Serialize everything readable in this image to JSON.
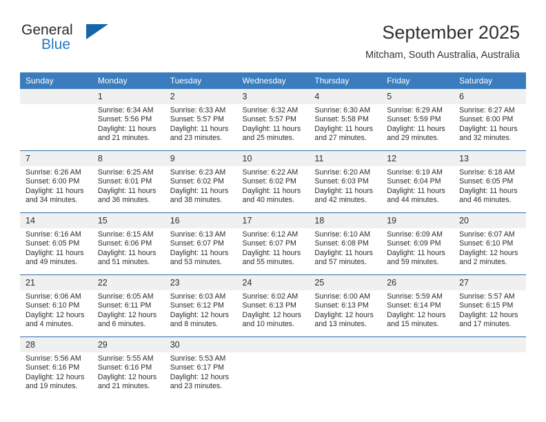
{
  "brand": {
    "name_part1": "General",
    "name_part2": "Blue",
    "flag_icon": "triangle-flag-icon"
  },
  "header": {
    "title": "September 2025",
    "location": "Mitcham, South Australia, Australia"
  },
  "weekday_headers": [
    "Sunday",
    "Monday",
    "Tuesday",
    "Wednesday",
    "Thursday",
    "Friday",
    "Saturday"
  ],
  "colors": {
    "header_blue": "#3a7cbe",
    "row_divider_blue": "#2e6da8",
    "daynum_band": "#f0f0f0",
    "brand_blue": "#2278c6"
  },
  "weeks": [
    [
      {
        "day": "",
        "sunrise": "",
        "sunset": "",
        "daylight_line1": "",
        "daylight_line2": "",
        "empty": true
      },
      {
        "day": "1",
        "sunrise": "Sunrise: 6:34 AM",
        "sunset": "Sunset: 5:56 PM",
        "daylight_line1": "Daylight: 11 hours",
        "daylight_line2": "and 21 minutes.",
        "empty": false
      },
      {
        "day": "2",
        "sunrise": "Sunrise: 6:33 AM",
        "sunset": "Sunset: 5:57 PM",
        "daylight_line1": "Daylight: 11 hours",
        "daylight_line2": "and 23 minutes.",
        "empty": false
      },
      {
        "day": "3",
        "sunrise": "Sunrise: 6:32 AM",
        "sunset": "Sunset: 5:57 PM",
        "daylight_line1": "Daylight: 11 hours",
        "daylight_line2": "and 25 minutes.",
        "empty": false
      },
      {
        "day": "4",
        "sunrise": "Sunrise: 6:30 AM",
        "sunset": "Sunset: 5:58 PM",
        "daylight_line1": "Daylight: 11 hours",
        "daylight_line2": "and 27 minutes.",
        "empty": false
      },
      {
        "day": "5",
        "sunrise": "Sunrise: 6:29 AM",
        "sunset": "Sunset: 5:59 PM",
        "daylight_line1": "Daylight: 11 hours",
        "daylight_line2": "and 29 minutes.",
        "empty": false
      },
      {
        "day": "6",
        "sunrise": "Sunrise: 6:27 AM",
        "sunset": "Sunset: 6:00 PM",
        "daylight_line1": "Daylight: 11 hours",
        "daylight_line2": "and 32 minutes.",
        "empty": false
      }
    ],
    [
      {
        "day": "7",
        "sunrise": "Sunrise: 6:26 AM",
        "sunset": "Sunset: 6:00 PM",
        "daylight_line1": "Daylight: 11 hours",
        "daylight_line2": "and 34 minutes.",
        "empty": false
      },
      {
        "day": "8",
        "sunrise": "Sunrise: 6:25 AM",
        "sunset": "Sunset: 6:01 PM",
        "daylight_line1": "Daylight: 11 hours",
        "daylight_line2": "and 36 minutes.",
        "empty": false
      },
      {
        "day": "9",
        "sunrise": "Sunrise: 6:23 AM",
        "sunset": "Sunset: 6:02 PM",
        "daylight_line1": "Daylight: 11 hours",
        "daylight_line2": "and 38 minutes.",
        "empty": false
      },
      {
        "day": "10",
        "sunrise": "Sunrise: 6:22 AM",
        "sunset": "Sunset: 6:02 PM",
        "daylight_line1": "Daylight: 11 hours",
        "daylight_line2": "and 40 minutes.",
        "empty": false
      },
      {
        "day": "11",
        "sunrise": "Sunrise: 6:20 AM",
        "sunset": "Sunset: 6:03 PM",
        "daylight_line1": "Daylight: 11 hours",
        "daylight_line2": "and 42 minutes.",
        "empty": false
      },
      {
        "day": "12",
        "sunrise": "Sunrise: 6:19 AM",
        "sunset": "Sunset: 6:04 PM",
        "daylight_line1": "Daylight: 11 hours",
        "daylight_line2": "and 44 minutes.",
        "empty": false
      },
      {
        "day": "13",
        "sunrise": "Sunrise: 6:18 AM",
        "sunset": "Sunset: 6:05 PM",
        "daylight_line1": "Daylight: 11 hours",
        "daylight_line2": "and 46 minutes.",
        "empty": false
      }
    ],
    [
      {
        "day": "14",
        "sunrise": "Sunrise: 6:16 AM",
        "sunset": "Sunset: 6:05 PM",
        "daylight_line1": "Daylight: 11 hours",
        "daylight_line2": "and 49 minutes.",
        "empty": false
      },
      {
        "day": "15",
        "sunrise": "Sunrise: 6:15 AM",
        "sunset": "Sunset: 6:06 PM",
        "daylight_line1": "Daylight: 11 hours",
        "daylight_line2": "and 51 minutes.",
        "empty": false
      },
      {
        "day": "16",
        "sunrise": "Sunrise: 6:13 AM",
        "sunset": "Sunset: 6:07 PM",
        "daylight_line1": "Daylight: 11 hours",
        "daylight_line2": "and 53 minutes.",
        "empty": false
      },
      {
        "day": "17",
        "sunrise": "Sunrise: 6:12 AM",
        "sunset": "Sunset: 6:07 PM",
        "daylight_line1": "Daylight: 11 hours",
        "daylight_line2": "and 55 minutes.",
        "empty": false
      },
      {
        "day": "18",
        "sunrise": "Sunrise: 6:10 AM",
        "sunset": "Sunset: 6:08 PM",
        "daylight_line1": "Daylight: 11 hours",
        "daylight_line2": "and 57 minutes.",
        "empty": false
      },
      {
        "day": "19",
        "sunrise": "Sunrise: 6:09 AM",
        "sunset": "Sunset: 6:09 PM",
        "daylight_line1": "Daylight: 11 hours",
        "daylight_line2": "and 59 minutes.",
        "empty": false
      },
      {
        "day": "20",
        "sunrise": "Sunrise: 6:07 AM",
        "sunset": "Sunset: 6:10 PM",
        "daylight_line1": "Daylight: 12 hours",
        "daylight_line2": "and 2 minutes.",
        "empty": false
      }
    ],
    [
      {
        "day": "21",
        "sunrise": "Sunrise: 6:06 AM",
        "sunset": "Sunset: 6:10 PM",
        "daylight_line1": "Daylight: 12 hours",
        "daylight_line2": "and 4 minutes.",
        "empty": false
      },
      {
        "day": "22",
        "sunrise": "Sunrise: 6:05 AM",
        "sunset": "Sunset: 6:11 PM",
        "daylight_line1": "Daylight: 12 hours",
        "daylight_line2": "and 6 minutes.",
        "empty": false
      },
      {
        "day": "23",
        "sunrise": "Sunrise: 6:03 AM",
        "sunset": "Sunset: 6:12 PM",
        "daylight_line1": "Daylight: 12 hours",
        "daylight_line2": "and 8 minutes.",
        "empty": false
      },
      {
        "day": "24",
        "sunrise": "Sunrise: 6:02 AM",
        "sunset": "Sunset: 6:13 PM",
        "daylight_line1": "Daylight: 12 hours",
        "daylight_line2": "and 10 minutes.",
        "empty": false
      },
      {
        "day": "25",
        "sunrise": "Sunrise: 6:00 AM",
        "sunset": "Sunset: 6:13 PM",
        "daylight_line1": "Daylight: 12 hours",
        "daylight_line2": "and 13 minutes.",
        "empty": false
      },
      {
        "day": "26",
        "sunrise": "Sunrise: 5:59 AM",
        "sunset": "Sunset: 6:14 PM",
        "daylight_line1": "Daylight: 12 hours",
        "daylight_line2": "and 15 minutes.",
        "empty": false
      },
      {
        "day": "27",
        "sunrise": "Sunrise: 5:57 AM",
        "sunset": "Sunset: 6:15 PM",
        "daylight_line1": "Daylight: 12 hours",
        "daylight_line2": "and 17 minutes.",
        "empty": false
      }
    ],
    [
      {
        "day": "28",
        "sunrise": "Sunrise: 5:56 AM",
        "sunset": "Sunset: 6:16 PM",
        "daylight_line1": "Daylight: 12 hours",
        "daylight_line2": "and 19 minutes.",
        "empty": false
      },
      {
        "day": "29",
        "sunrise": "Sunrise: 5:55 AM",
        "sunset": "Sunset: 6:16 PM",
        "daylight_line1": "Daylight: 12 hours",
        "daylight_line2": "and 21 minutes.",
        "empty": false
      },
      {
        "day": "30",
        "sunrise": "Sunrise: 5:53 AM",
        "sunset": "Sunset: 6:17 PM",
        "daylight_line1": "Daylight: 12 hours",
        "daylight_line2": "and 23 minutes.",
        "empty": false
      },
      {
        "day": "",
        "sunrise": "",
        "sunset": "",
        "daylight_line1": "",
        "daylight_line2": "",
        "empty": true
      },
      {
        "day": "",
        "sunrise": "",
        "sunset": "",
        "daylight_line1": "",
        "daylight_line2": "",
        "empty": true
      },
      {
        "day": "",
        "sunrise": "",
        "sunset": "",
        "daylight_line1": "",
        "daylight_line2": "",
        "empty": true
      },
      {
        "day": "",
        "sunrise": "",
        "sunset": "",
        "daylight_line1": "",
        "daylight_line2": "",
        "empty": true
      }
    ]
  ]
}
